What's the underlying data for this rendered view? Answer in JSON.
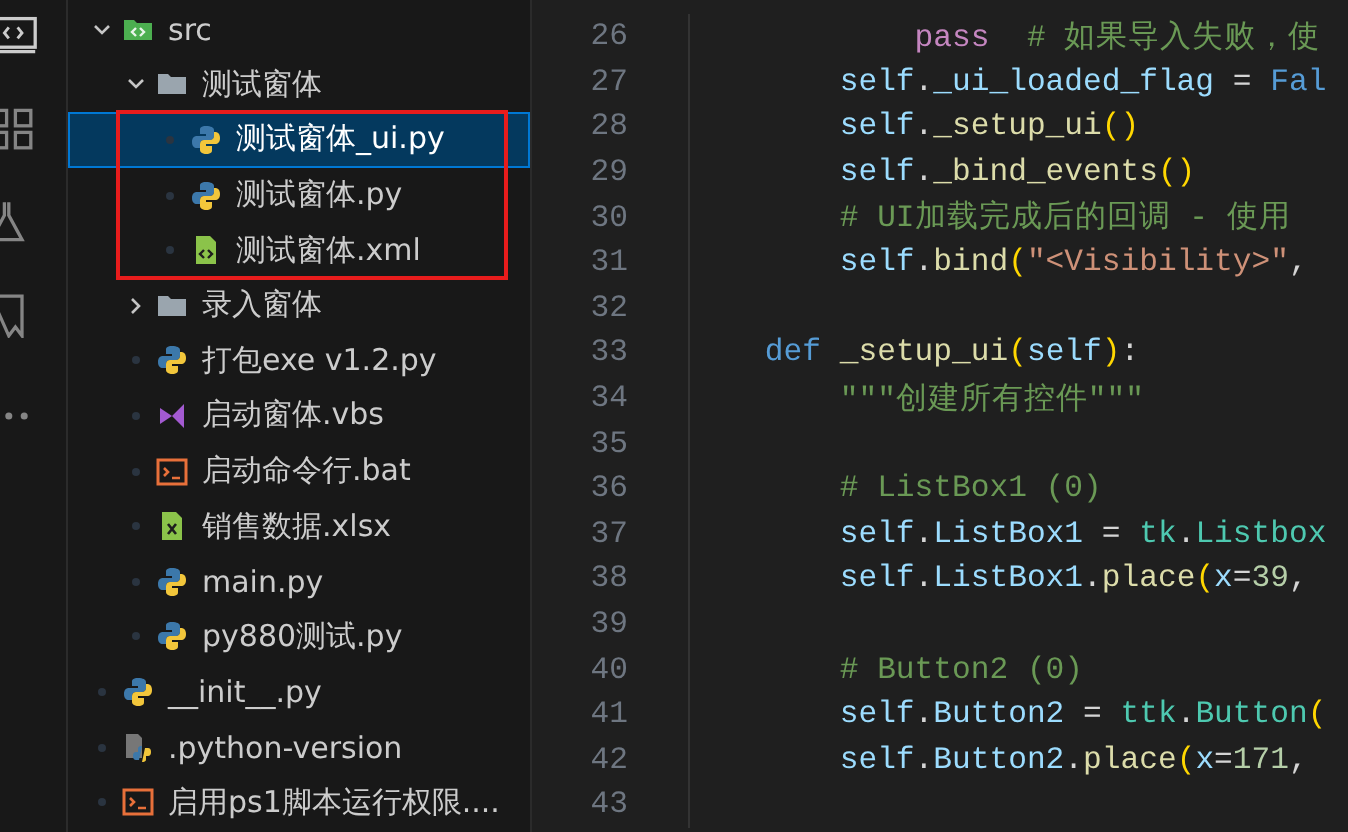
{
  "explorer": {
    "items": [
      {
        "name": "src",
        "kind": "src-folder",
        "expanded": true,
        "children": [
          {
            "name": "测试窗体",
            "kind": "folder",
            "expanded": true,
            "children_highlighted": true,
            "children": [
              {
                "name": "测试窗体_ui.py",
                "kind": "python",
                "selected": true
              },
              {
                "name": "测试窗体.py",
                "kind": "python",
                "selected": false
              },
              {
                "name": "测试窗体.xml",
                "kind": "xml",
                "selected": false
              }
            ]
          },
          {
            "name": "录入窗体",
            "kind": "folder",
            "expanded": false
          },
          {
            "name": "打包exe  v1.2.py",
            "kind": "python",
            "selected": false
          },
          {
            "name": "启动窗体.vbs",
            "kind": "vbs",
            "selected": false
          },
          {
            "name": "启动命令行.bat",
            "kind": "bat",
            "selected": false
          },
          {
            "name": "销售数据.xlsx",
            "kind": "xlsx",
            "selected": false
          },
          {
            "name": "main.py",
            "kind": "python",
            "selected": false
          },
          {
            "name": "py880测试.py",
            "kind": "python",
            "selected": false
          }
        ]
      },
      {
        "name": "__init__.py",
        "kind": "python",
        "selected": false
      },
      {
        "name": ".python-version",
        "kind": "pyversion",
        "selected": false
      },
      {
        "name": "启用ps1脚本运行权限....",
        "kind": "bat",
        "selected": false
      }
    ]
  },
  "editor": {
    "lines": [
      {
        "number": "26",
        "tokens": [
          {
            "text": "            pass",
            "kind": "control"
          },
          {
            "text": "  # 如果导入失败，使",
            "kind": "comment"
          }
        ]
      },
      {
        "number": "27",
        "tokens": [
          {
            "text": "        self",
            "kind": "var"
          },
          {
            "text": ".",
            "kind": "plain"
          },
          {
            "text": "_ui_loaded_flag",
            "kind": "var"
          },
          {
            "text": " = ",
            "kind": "plain"
          },
          {
            "text": "Fal",
            "kind": "keyword"
          }
        ]
      },
      {
        "number": "28",
        "tokens": [
          {
            "text": "        self",
            "kind": "var"
          },
          {
            "text": ".",
            "kind": "plain"
          },
          {
            "text": "_setup_ui",
            "kind": "func"
          },
          {
            "text": "()",
            "kind": "paren"
          }
        ]
      },
      {
        "number": "29",
        "tokens": [
          {
            "text": "        self",
            "kind": "var"
          },
          {
            "text": ".",
            "kind": "plain"
          },
          {
            "text": "_bind_events",
            "kind": "func"
          },
          {
            "text": "()",
            "kind": "paren"
          }
        ]
      },
      {
        "number": "30",
        "tokens": [
          {
            "text": "        # UI加载完成后的回调 - 使用",
            "kind": "comment"
          }
        ]
      },
      {
        "number": "31",
        "tokens": [
          {
            "text": "        self",
            "kind": "var"
          },
          {
            "text": ".",
            "kind": "plain"
          },
          {
            "text": "bind",
            "kind": "func"
          },
          {
            "text": "(",
            "kind": "paren"
          },
          {
            "text": "\"<Visibility>\"",
            "kind": "string"
          },
          {
            "text": ",",
            "kind": "plain"
          }
        ]
      },
      {
        "number": "32"
      },
      {
        "number": "33",
        "tokens": [
          {
            "text": "    def ",
            "kind": "keyword"
          },
          {
            "text": "_setup_ui",
            "kind": "func"
          },
          {
            "text": "(",
            "kind": "paren"
          },
          {
            "text": "self",
            "kind": "var"
          },
          {
            "text": ")",
            "kind": "paren"
          },
          {
            "text": ":",
            "kind": "plain"
          }
        ]
      },
      {
        "number": "34",
        "tokens": [
          {
            "text": "        \"\"\"创建所有控件\"\"\"",
            "kind": "comment"
          }
        ]
      },
      {
        "number": "35"
      },
      {
        "number": "36",
        "tokens": [
          {
            "text": "        # ListBox1 (0)",
            "kind": "comment"
          }
        ]
      },
      {
        "number": "37",
        "tokens": [
          {
            "text": "        self",
            "kind": "var"
          },
          {
            "text": ".",
            "kind": "plain"
          },
          {
            "text": "ListBox1",
            "kind": "var"
          },
          {
            "text": " = ",
            "kind": "plain"
          },
          {
            "text": "tk",
            "kind": "class"
          },
          {
            "text": ".",
            "kind": "plain"
          },
          {
            "text": "Listbox",
            "kind": "class"
          }
        ]
      },
      {
        "number": "38",
        "tokens": [
          {
            "text": "        self",
            "kind": "var"
          },
          {
            "text": ".",
            "kind": "plain"
          },
          {
            "text": "ListBox1",
            "kind": "var"
          },
          {
            "text": ".",
            "kind": "plain"
          },
          {
            "text": "place",
            "kind": "func"
          },
          {
            "text": "(",
            "kind": "paren"
          },
          {
            "text": "x",
            "kind": "var"
          },
          {
            "text": "=",
            "kind": "plain"
          },
          {
            "text": "39",
            "kind": "number"
          },
          {
            "text": ",",
            "kind": "plain"
          }
        ]
      },
      {
        "number": "39"
      },
      {
        "number": "40",
        "tokens": [
          {
            "text": "        # Button2 (0)",
            "kind": "comment"
          }
        ]
      },
      {
        "number": "41",
        "tokens": [
          {
            "text": "        self",
            "kind": "var"
          },
          {
            "text": ".",
            "kind": "plain"
          },
          {
            "text": "Button2",
            "kind": "var"
          },
          {
            "text": " = ",
            "kind": "plain"
          },
          {
            "text": "ttk",
            "kind": "class"
          },
          {
            "text": ".",
            "kind": "plain"
          },
          {
            "text": "Button",
            "kind": "class"
          },
          {
            "text": "(",
            "kind": "paren"
          }
        ]
      },
      {
        "number": "42",
        "tokens": [
          {
            "text": "        self",
            "kind": "var"
          },
          {
            "text": ".",
            "kind": "plain"
          },
          {
            "text": "Button2",
            "kind": "var"
          },
          {
            "text": ".",
            "kind": "plain"
          },
          {
            "text": "place",
            "kind": "func"
          },
          {
            "text": "(",
            "kind": "paren"
          },
          {
            "text": "x",
            "kind": "var"
          },
          {
            "text": "=",
            "kind": "plain"
          },
          {
            "text": "171",
            "kind": "number"
          },
          {
            "text": ",",
            "kind": "plain"
          }
        ]
      },
      {
        "number": "43"
      }
    ]
  }
}
